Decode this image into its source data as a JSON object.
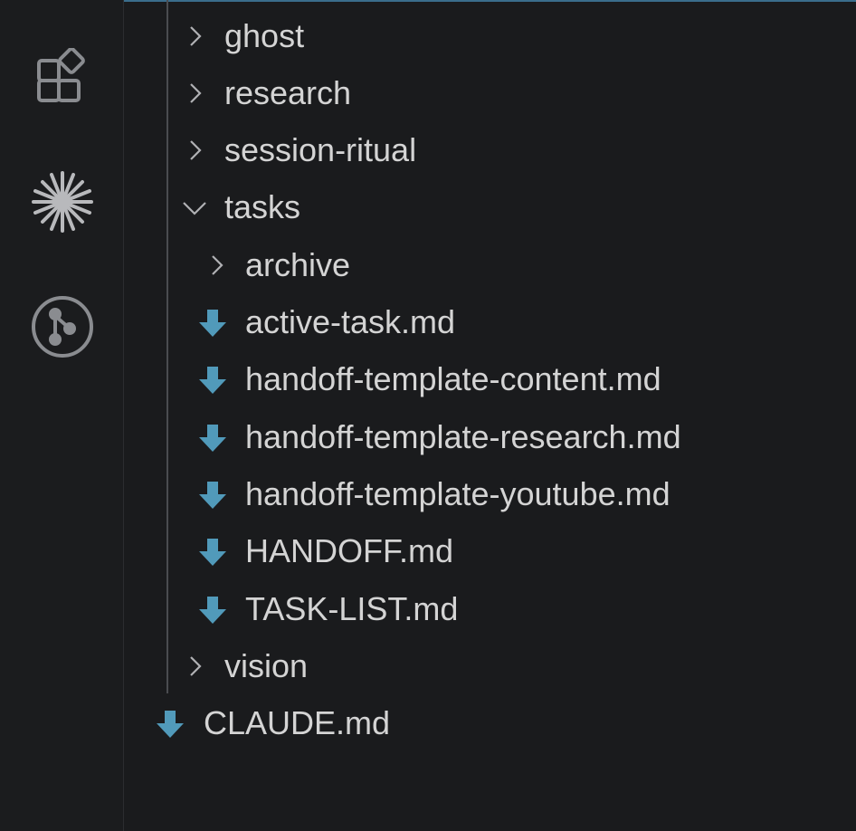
{
  "activity_bar": {
    "icons": [
      "extensions-icon",
      "claude-icon",
      "source-control-icon"
    ]
  },
  "tree": {
    "rows": [
      {
        "label": "ghost",
        "type": "folder",
        "expanded": false
      },
      {
        "label": "research",
        "type": "folder",
        "expanded": false
      },
      {
        "label": "session-ritual",
        "type": "folder",
        "expanded": false
      },
      {
        "label": "tasks",
        "type": "folder",
        "expanded": true
      },
      {
        "label": "archive",
        "type": "folder",
        "expanded": false
      },
      {
        "label": "active-task.md",
        "type": "file"
      },
      {
        "label": "handoff-template-content.md",
        "type": "file"
      },
      {
        "label": "handoff-template-research.md",
        "type": "file"
      },
      {
        "label": "handoff-template-youtube.md",
        "type": "file"
      },
      {
        "label": "HANDOFF.md",
        "type": "file"
      },
      {
        "label": "TASK-LIST.md",
        "type": "file"
      },
      {
        "label": "vision",
        "type": "folder",
        "expanded": false
      },
      {
        "label": "CLAUDE.md",
        "type": "file"
      }
    ]
  },
  "colors": {
    "background": "#1a1b1d",
    "text": "#d4d4d4",
    "icon": "#8a8c90",
    "markdown_icon": "#519aba"
  }
}
